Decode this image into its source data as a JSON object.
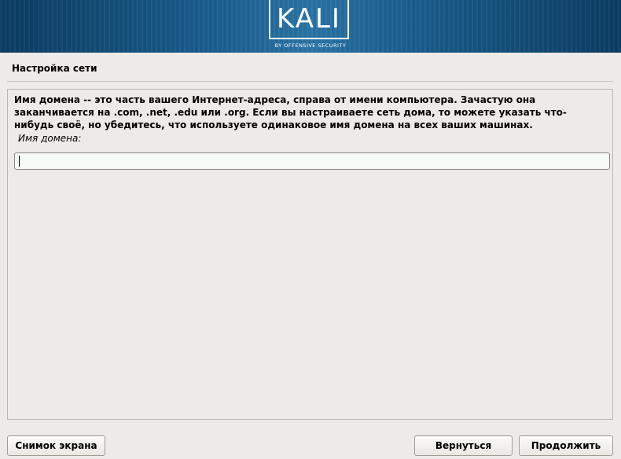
{
  "banner": {
    "logo_text": "KALI",
    "logo_subtitle": "BY OFFENSIVE SECURITY"
  },
  "page": {
    "title": "Настройка сети"
  },
  "main": {
    "description_line1": "Имя домена -- это часть вашего Интернет-адреса, справа от имени компьютера. Зачастую она",
    "description_line2": "заканчивается на .com, .net, .edu или .org. Если вы настраиваете сеть дома, то можете указать что-",
    "description_line3": "нибудь своё, но убедитесь, что используете одинаковое имя домена на всех ваших машинах.",
    "field_label": "Имя домена:",
    "field_value": ""
  },
  "buttons": {
    "screenshot": "Снимок экрана",
    "back": "Вернуться",
    "continue": "Продолжить"
  },
  "colors": {
    "background": "#edebe7",
    "banner": "#1b5f8f",
    "input_background": "#f6fbf6"
  }
}
